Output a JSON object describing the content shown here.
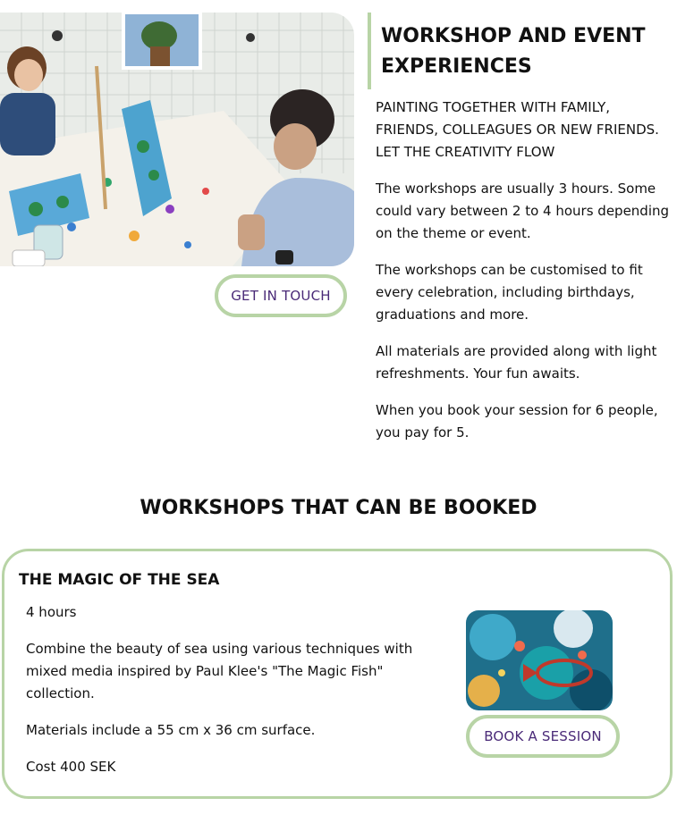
{
  "hero": {
    "image_alt": "Participants painting at a workshop table",
    "cta_label": "GET IN TOUCH"
  },
  "intro": {
    "heading": "WORKSHOP AND EVENT EXPERIENCES",
    "tagline": "PAINTING TOGETHER WITH FAMILY, FRIENDS, COLLEAGUES OR NEW FRIENDS. LET THE CREATIVITY FLOW",
    "paragraphs": [
      "The workshops are usually 3 hours. Some could vary between 2 to 4 hours depending on the theme or event.",
      "The workshops can be customised to fit every celebration, including birthdays, graduations and more.",
      "All materials are provided along with light refreshments. Your fun awaits.",
      "When you book your session for 6 people, you pay for 5."
    ]
  },
  "workshops": {
    "section_title": "WORKSHOPS THAT CAN BE BOOKED",
    "items": [
      {
        "title": "THE MAGIC OF THE SEA",
        "duration": "4 hours",
        "description": "Combine the beauty of sea using various techniques with mixed media inspired by Paul Klee's \"The Magic Fish\" collection.",
        "materials": "Materials include a 55 cm x 36 cm surface.",
        "cost": "Cost 400 SEK",
        "image_alt": "Colourful painting of fish in the sea",
        "cta_label": "BOOK A SESSION"
      }
    ]
  },
  "colors": {
    "accent_green": "#b8d4a6",
    "button_text_purple": "#4a2a78"
  }
}
